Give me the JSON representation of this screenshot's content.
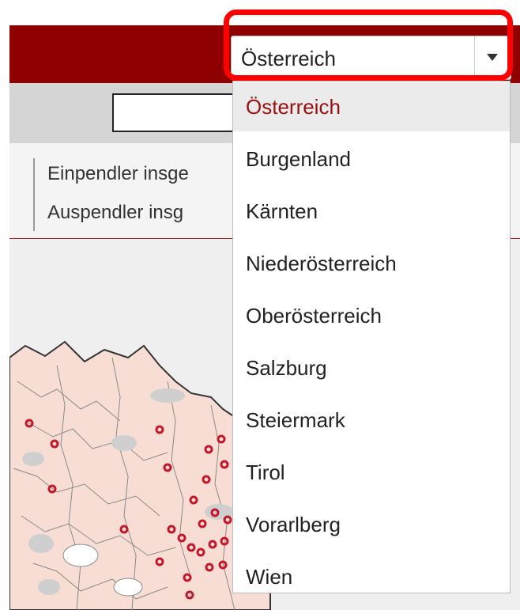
{
  "stats": {
    "einpendler": "Einpendler insge",
    "auspendler": "Auspendler insg"
  },
  "dropdown": {
    "selected": "Österreich",
    "options": [
      "Österreich",
      "Burgenland",
      "Kärnten",
      "Niederösterreich",
      "Oberösterreich",
      "Salzburg",
      "Steiermark",
      "Tirol",
      "Vorarlberg",
      "Wien"
    ]
  },
  "colors": {
    "header": "#8f0000",
    "highlight": "#ff0000",
    "marker": "#c4172b",
    "map_region": "#f7ddd3"
  }
}
